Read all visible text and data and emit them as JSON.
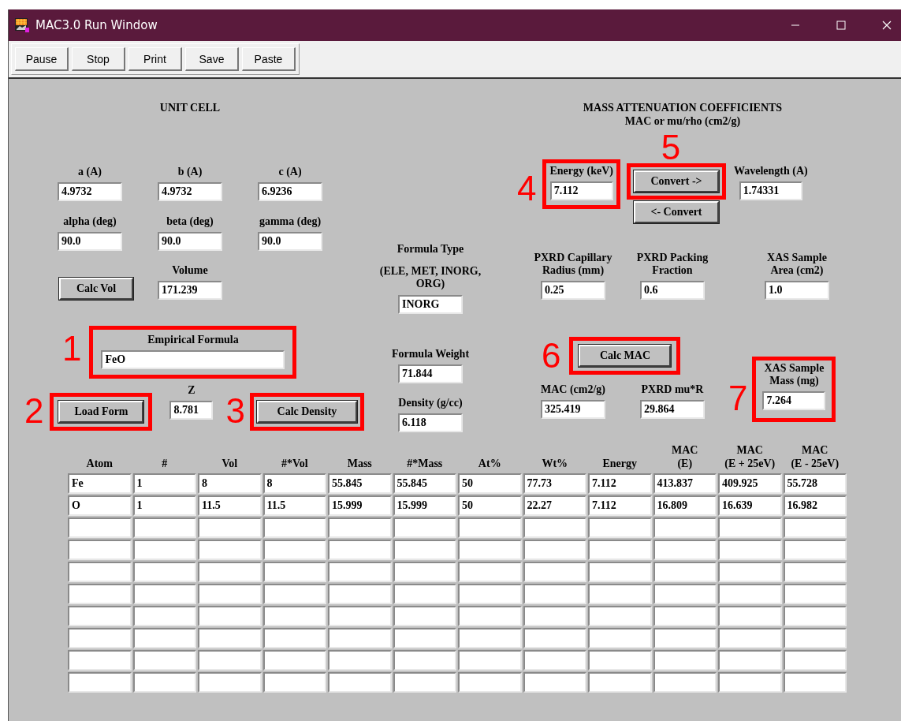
{
  "window": {
    "title": "MAC3.0 Run Window"
  },
  "toolbar": [
    "Pause",
    "Stop",
    "Print",
    "Save",
    "Paste"
  ],
  "unit_cell": {
    "title": "UNIT CELL",
    "fields": [
      {
        "label": "a (A)",
        "value": "4.9732"
      },
      {
        "label": "b (A)",
        "value": "4.9732"
      },
      {
        "label": "c (A)",
        "value": "6.9236"
      },
      {
        "label": "alpha (deg)",
        "value": "90.0"
      },
      {
        "label": "beta (deg)",
        "value": "90.0"
      },
      {
        "label": "gamma (deg)",
        "value": "90.0"
      }
    ],
    "calc_button": "Calc Vol",
    "volume": {
      "label": "Volume",
      "value": "171.239"
    }
  },
  "formula": {
    "empirical": {
      "label": "Empirical Formula",
      "value": "FeO",
      "callout": "1"
    },
    "load_button": {
      "label": "Load Form",
      "callout": "2"
    },
    "z": {
      "label": "Z",
      "value": "8.781"
    },
    "density_button": {
      "label": "Calc Density",
      "callout": "3"
    },
    "type": {
      "label": "Formula Type",
      "hint": "(ELE, MET, INORG, ORG)",
      "value": "INORG"
    },
    "weight": {
      "label": "Formula Weight",
      "value": "71.844"
    },
    "density": {
      "label": "Density (g/cc)",
      "value": "6.118"
    }
  },
  "mac": {
    "title": "MASS ATTENUATION COEFFICIENTS",
    "subtitle": "MAC or mu/rho (cm2/g)",
    "energy": {
      "label": "Energy (keV)",
      "value": "7.112",
      "callout": "4"
    },
    "convert_forward": {
      "label": "Convert ->",
      "callout": "5"
    },
    "convert_back": {
      "label": "<- Convert"
    },
    "wavelength": {
      "label": "Wavelength (A)",
      "value": "1.74331"
    },
    "capillary": {
      "label": "PXRD Capillary\nRadius (mm)",
      "value": "0.25"
    },
    "packing": {
      "label": "PXRD Packing\nFraction",
      "value": "0.6"
    },
    "xas_area": {
      "label": "XAS Sample\nArea (cm2)",
      "value": "1.0"
    },
    "calc_button": {
      "label": "Calc MAC",
      "callout": "6"
    },
    "mac_value": {
      "label": "MAC (cm2/g)",
      "value": "325.419"
    },
    "mu_r": {
      "label": "PXRD mu*R",
      "value": "29.864"
    },
    "xas_mass": {
      "label": "XAS Sample\nMass (mg)",
      "value": "7.264",
      "callout": "7"
    }
  },
  "table": {
    "columns": [
      "Atom",
      "#",
      "Vol",
      "#*Vol",
      "Mass",
      "#*Mass",
      "At%",
      "Wt%",
      "Energy",
      "MAC\n(E)",
      "MAC\n(E + 25eV)",
      "MAC\n(E - 25eV)"
    ],
    "rows": [
      {
        "kind": "data",
        "cells": [
          "Fe",
          "1",
          "8",
          "8",
          "55.845",
          "55.845",
          "50",
          "77.73",
          "7.112",
          "413.837",
          "409.925",
          "55.728"
        ]
      },
      {
        "kind": "data",
        "cells": [
          "O",
          "1",
          "11.5",
          "11.5",
          "15.999",
          "15.999",
          "50",
          "22.27",
          "7.112",
          "16.809",
          "16.639",
          "16.982"
        ]
      },
      {
        "kind": "blank"
      },
      {
        "kind": "blank"
      },
      {
        "kind": "blank"
      },
      {
        "kind": "blank"
      },
      {
        "kind": "blank"
      },
      {
        "kind": "blank"
      },
      {
        "kind": "blank"
      },
      {
        "kind": "blank"
      }
    ]
  }
}
